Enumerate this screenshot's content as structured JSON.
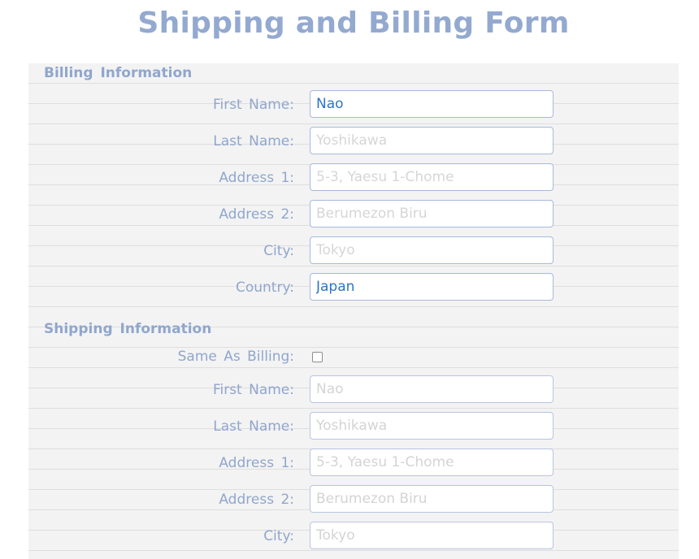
{
  "page": {
    "title": "Shipping and Billing Form"
  },
  "billing": {
    "section_title": "Billing Information",
    "fields": [
      {
        "label": "First Name:",
        "value": "Nao",
        "placeholder": ""
      },
      {
        "label": "Last Name:",
        "value": "",
        "placeholder": "Yoshikawa"
      },
      {
        "label": "Address 1:",
        "value": "",
        "placeholder": "5-3, Yaesu 1-Chome"
      },
      {
        "label": "Address 2:",
        "value": "",
        "placeholder": "Berumezon Biru"
      },
      {
        "label": "City:",
        "value": "",
        "placeholder": "Tokyo"
      },
      {
        "label": "Country:",
        "value": "Japan",
        "placeholder": ""
      }
    ]
  },
  "shipping": {
    "section_title": "Shipping Information",
    "same_as_billing": {
      "label": "Same As Billing:",
      "checked": false
    },
    "fields": [
      {
        "label": "First Name:",
        "value": "Nao"
      },
      {
        "label": "Last Name:",
        "value": "Yoshikawa"
      },
      {
        "label": "Address 1:",
        "value": "5-3, Yaesu 1-Chome"
      },
      {
        "label": "Address 2:",
        "value": "Berumezon Biru"
      },
      {
        "label": "City:",
        "value": "Tokyo"
      }
    ]
  },
  "colors": {
    "title": "#93a9d0",
    "label": "#90a6cd",
    "input_text": "#2c74c8",
    "input_border": "#a8b8dc",
    "placeholder": "#d6d6d6"
  }
}
